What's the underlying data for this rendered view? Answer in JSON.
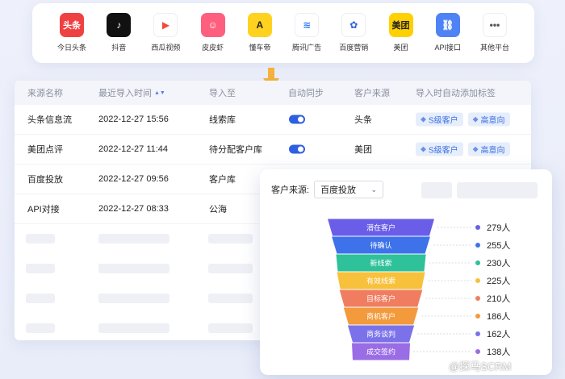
{
  "platforms": [
    {
      "label": "今日头条",
      "icon": "toutiao-icon",
      "glyph": "头条",
      "bg": "#f04142",
      "fg": "#ffffff"
    },
    {
      "label": "抖音",
      "icon": "douyin-icon",
      "glyph": "♪",
      "bg": "#111111",
      "fg": "#ffffff"
    },
    {
      "label": "西瓜视频",
      "icon": "xigua-video-icon",
      "glyph": "▶",
      "bg": "#ffffff",
      "fg": "#f04a3e"
    },
    {
      "label": "皮皮虾",
      "icon": "pipixia-icon",
      "glyph": "☺",
      "bg": "#ff5f7e",
      "fg": "#ffffff"
    },
    {
      "label": "懂车帝",
      "icon": "dongchedi-icon",
      "glyph": "A",
      "bg": "#ffd21f",
      "fg": "#222222"
    },
    {
      "label": "腾讯广告",
      "icon": "tencent-ads-icon",
      "glyph": "≋",
      "bg": "#ffffff",
      "fg": "#2e7cf6"
    },
    {
      "label": "百度营销",
      "icon": "baidu-marketing-icon",
      "glyph": "✿",
      "bg": "#ffffff",
      "fg": "#2e5ee0"
    },
    {
      "label": "美团",
      "icon": "meituan-icon",
      "glyph": "美团",
      "bg": "#ffd000",
      "fg": "#222222"
    },
    {
      "label": "API接口",
      "icon": "api-link-icon",
      "glyph": "⛓",
      "bg": "#4f83f5",
      "fg": "#ffffff"
    },
    {
      "label": "其他平台",
      "icon": "more-dots-icon",
      "glyph": "•••",
      "bg": "#ffffff",
      "fg": "#555555"
    }
  ],
  "table": {
    "headers": [
      "来源名称",
      "最近导入时间",
      "导入至",
      "自动同步",
      "客户来源",
      "导入时自动添加标签"
    ],
    "sort_glyph": "▲▼",
    "rows": [
      {
        "source": "头条信息流",
        "time": "2022-12-27 15:56",
        "target": "线索库",
        "sync": true,
        "customer_source": "头条",
        "tags": [
          "S级客户",
          "高意向"
        ]
      },
      {
        "source": "美团点评",
        "time": "2022-12-27 11:44",
        "target": "待分配客户库",
        "sync": true,
        "customer_source": "美团",
        "tags": [
          "S级客户",
          "高意向"
        ]
      },
      {
        "source": "百度投放",
        "time": "2022-12-27 09:56",
        "target": "客户库"
      },
      {
        "source": "API对接",
        "time": "2022-12-27 08:33",
        "target": "公海"
      }
    ]
  },
  "funnel": {
    "label": "客户来源:",
    "selected": "百度投放",
    "chevron": "⌄"
  },
  "chart_data": {
    "type": "funnel",
    "stages": [
      "潜在客户",
      "待确认",
      "新线索",
      "有效线索",
      "目标客户",
      "商机客户",
      "商务谈判",
      "成交签约"
    ],
    "values": [
      279,
      255,
      230,
      225,
      210,
      186,
      162,
      138
    ],
    "value_labels": [
      "279人",
      "255人",
      "230人",
      "225人",
      "210人",
      "186人",
      "162人",
      "138人"
    ],
    "colors": [
      "#6a5ee8",
      "#3d72ea",
      "#2ec19a",
      "#f7c13b",
      "#f07d60",
      "#f29a3c",
      "#7b72ea",
      "#9a6ce6"
    ]
  },
  "watermark": "@探马SCRM"
}
